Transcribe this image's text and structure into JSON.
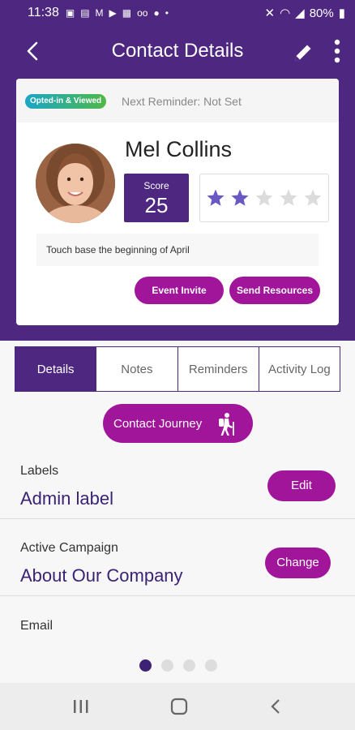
{
  "status_bar": {
    "time": "11:38",
    "battery": "80%"
  },
  "app_bar": {
    "title": "Contact Details"
  },
  "card": {
    "opt_badge": "Opted-in & Viewed",
    "next_reminder": "Next Reminder: Not Set",
    "name": "Mel Collins",
    "score_label": "Score",
    "score_value": "25",
    "rating": 2,
    "rating_max": 5,
    "note": "Touch base the beginning of April",
    "event_invite_label": "Event Invite",
    "send_resources_label": "Send Resources"
  },
  "tabs": [
    {
      "label": "Details",
      "active": true
    },
    {
      "label": "Notes",
      "active": false
    },
    {
      "label": "Reminders",
      "active": false
    },
    {
      "label": "Activity Log",
      "active": false
    }
  ],
  "journey_button": {
    "label": "Contact Journey",
    "icon": "hiker-icon"
  },
  "fields": {
    "labels": {
      "label": "Labels",
      "value": "Admin label",
      "button": "Edit"
    },
    "campaign": {
      "label": "Active Campaign",
      "value": "About Our Company",
      "button": "Change"
    },
    "email": {
      "label": "Email"
    }
  },
  "pager": {
    "count": 4,
    "active": 1
  },
  "colors": {
    "brand_purple": "#4e2781",
    "accent_magenta": "#a0159a",
    "star_filled": "#6a58c4",
    "star_empty": "#dcdcdc"
  }
}
